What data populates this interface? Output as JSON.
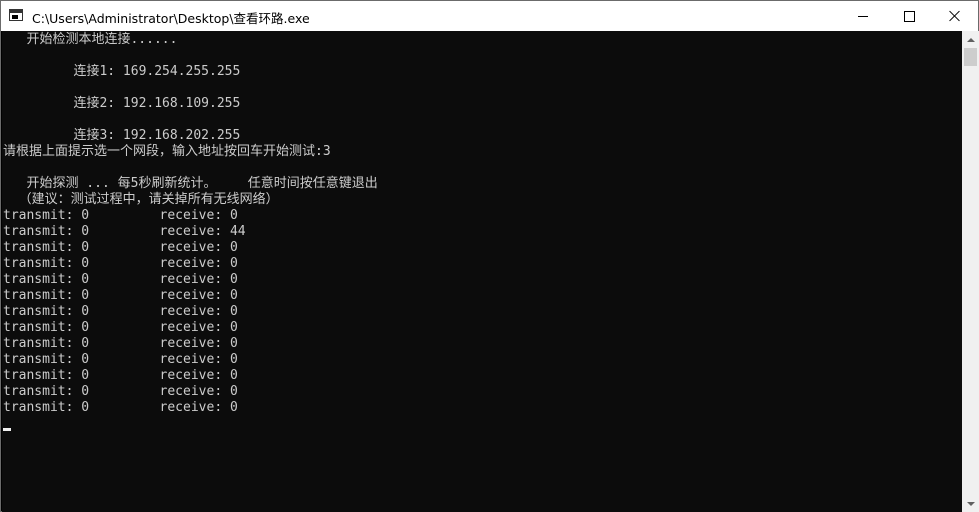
{
  "window": {
    "title": "C:\\Users\\Administrator\\Desktop\\查看环路.exe",
    "icon": "console-app-icon",
    "controls": [
      "minimize-icon",
      "maximize-icon",
      "close-icon"
    ]
  },
  "console": {
    "lines": [
      "   开始检测本地连接......",
      "         连接1: 169.254.255.255",
      "         连接2: 192.168.109.255",
      "         连接3: 192.168.202.255",
      "请根据上面提示选一个网段，输入地址按回车开始测试:3",
      "   开始探测 ... 每5秒刷新统计。    任意时间按任意键退出",
      "  （建议：测试过程中，请关掉所有无线网络）",
      "transmit: 0         receive: 0",
      "transmit: 0         receive: 44",
      "transmit: 0         receive: 0",
      "transmit: 0         receive: 0",
      "transmit: 0         receive: 0",
      "transmit: 0         receive: 0",
      "transmit: 0         receive: 0",
      "transmit: 0         receive: 0",
      "transmit: 0         receive: 0",
      "transmit: 0         receive: 0",
      "transmit: 0         receive: 0",
      "transmit: 0         receive: 0",
      "transmit: 0         receive: 0"
    ],
    "text_color": "#cccccc",
    "background": "#0c0c0c"
  }
}
